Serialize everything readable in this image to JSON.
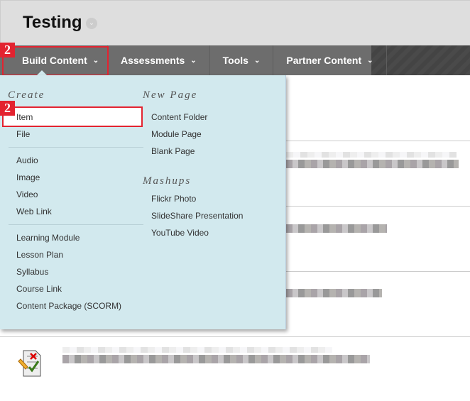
{
  "header": {
    "title": "Testing"
  },
  "nav": {
    "items": [
      {
        "label": "Build Content"
      },
      {
        "label": "Assessments"
      },
      {
        "label": "Tools"
      },
      {
        "label": "Partner Content"
      }
    ]
  },
  "annotations": {
    "badge1": "2",
    "badge2": "2"
  },
  "menu": {
    "create_heading": "Create",
    "create_groups": [
      [
        "Item",
        "File"
      ],
      [
        "Audio",
        "Image",
        "Video",
        "Web Link"
      ],
      [
        "Learning Module",
        "Lesson Plan",
        "Syllabus",
        "Course Link",
        "Content Package (SCORM)"
      ]
    ],
    "new_page_heading": "New Page",
    "new_page_items": [
      "Content Folder",
      "Module Page",
      "Blank Page"
    ],
    "mashups_heading": "Mashups",
    "mashups_items": [
      "Flickr Photo",
      "SlideShare Presentation",
      "YouTube Video"
    ]
  },
  "colors": {
    "accent": "#e32330",
    "menu_bg": "#d2e9ee",
    "nav_bg": "#6d6d6d"
  }
}
